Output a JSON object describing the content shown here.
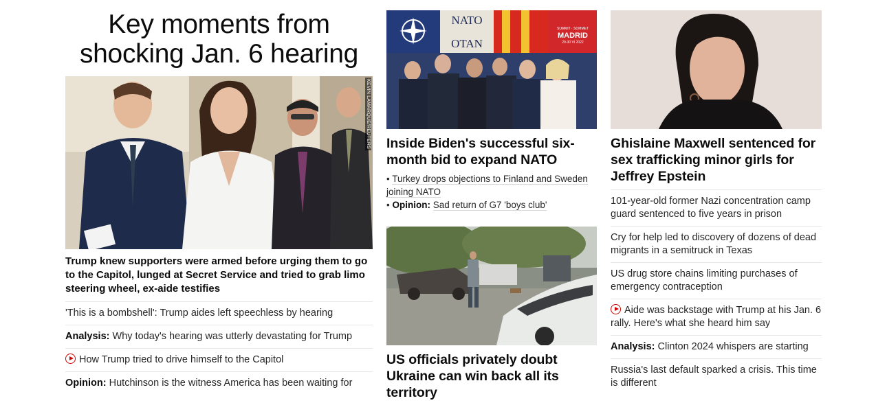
{
  "col1": {
    "headline_line1": "Key moments from",
    "headline_line2": "shocking Jan. 6 hearing",
    "photo_credit": "KEVIN LAMARQUE/REUTERS",
    "lead": "Trump knew supporters were armed before urging them to go to the Capitol, lunged at Secret Service and tried to grab limo steering wheel, ex-aide testifies",
    "links": [
      {
        "prefix": "",
        "text": "'This is a bombshell': Trump aides left speechless by hearing"
      },
      {
        "prefix": "Analysis:",
        "text": "Why today's hearing was utterly devastating for Trump"
      },
      {
        "prefix": "",
        "text": "How Trump tried to drive himself to the Capitol",
        "icon": "play-icon"
      },
      {
        "prefix": "Opinion:",
        "text": "Hutchinson is the witness America has been waiting for"
      }
    ]
  },
  "col2": {
    "card1": {
      "photo_sign_top": "NATO",
      "photo_sign_bottom": "OTAN",
      "photo_summit": "SUMMIT · SOMMET",
      "photo_city": "MADRID",
      "photo_date": "29-30 VI 2022",
      "headline": "Inside Biden's successful six-month bid to expand NATO",
      "bullet1": "Turkey drops objections to Finland and Sweden joining NATO",
      "bullet2_prefix": "Opinion:",
      "bullet2": "Sad return of G7 'boys club'"
    },
    "card2": {
      "headline": "US officials privately doubt Ukraine can win back all its territory"
    }
  },
  "col3": {
    "headline": "Ghislaine Maxwell sentenced for sex trafficking minor girls for Jeffrey Epstein",
    "links": [
      {
        "prefix": "",
        "text": "101-year-old former Nazi concentration camp guard sentenced to five years in prison"
      },
      {
        "prefix": "",
        "text": "Cry for help led to discovery of dozens of dead migrants in a semitruck in Texas"
      },
      {
        "prefix": "",
        "text": "US drug store chains limiting purchases of emergency contraception"
      },
      {
        "prefix": "",
        "text": "Aide was backstage with Trump at his Jan. 6 rally. Here's what she heard him say",
        "icon": "play-icon"
      },
      {
        "prefix": "Analysis:",
        "text": "Clinton 2024 whispers are starting"
      },
      {
        "prefix": "",
        "text": "Russia's last default sparked a crisis. This time is different"
      }
    ]
  },
  "colors": {
    "accent_red": "#cc0000",
    "text": "#0c0c0c",
    "divider": "#e6e6e6"
  }
}
